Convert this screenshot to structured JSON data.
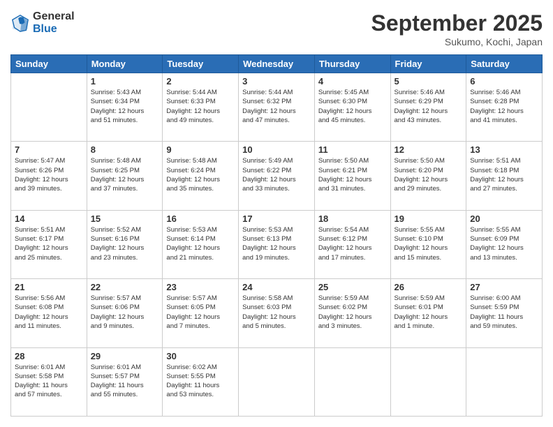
{
  "logo": {
    "general": "General",
    "blue": "Blue"
  },
  "header": {
    "month": "September 2025",
    "location": "Sukumo, Kochi, Japan"
  },
  "days_of_week": [
    "Sunday",
    "Monday",
    "Tuesday",
    "Wednesday",
    "Thursday",
    "Friday",
    "Saturday"
  ],
  "weeks": [
    [
      {
        "day": "",
        "info": ""
      },
      {
        "day": "1",
        "info": "Sunrise: 5:43 AM\nSunset: 6:34 PM\nDaylight: 12 hours\nand 51 minutes."
      },
      {
        "day": "2",
        "info": "Sunrise: 5:44 AM\nSunset: 6:33 PM\nDaylight: 12 hours\nand 49 minutes."
      },
      {
        "day": "3",
        "info": "Sunrise: 5:44 AM\nSunset: 6:32 PM\nDaylight: 12 hours\nand 47 minutes."
      },
      {
        "day": "4",
        "info": "Sunrise: 5:45 AM\nSunset: 6:30 PM\nDaylight: 12 hours\nand 45 minutes."
      },
      {
        "day": "5",
        "info": "Sunrise: 5:46 AM\nSunset: 6:29 PM\nDaylight: 12 hours\nand 43 minutes."
      },
      {
        "day": "6",
        "info": "Sunrise: 5:46 AM\nSunset: 6:28 PM\nDaylight: 12 hours\nand 41 minutes."
      }
    ],
    [
      {
        "day": "7",
        "info": "Sunrise: 5:47 AM\nSunset: 6:26 PM\nDaylight: 12 hours\nand 39 minutes."
      },
      {
        "day": "8",
        "info": "Sunrise: 5:48 AM\nSunset: 6:25 PM\nDaylight: 12 hours\nand 37 minutes."
      },
      {
        "day": "9",
        "info": "Sunrise: 5:48 AM\nSunset: 6:24 PM\nDaylight: 12 hours\nand 35 minutes."
      },
      {
        "day": "10",
        "info": "Sunrise: 5:49 AM\nSunset: 6:22 PM\nDaylight: 12 hours\nand 33 minutes."
      },
      {
        "day": "11",
        "info": "Sunrise: 5:50 AM\nSunset: 6:21 PM\nDaylight: 12 hours\nand 31 minutes."
      },
      {
        "day": "12",
        "info": "Sunrise: 5:50 AM\nSunset: 6:20 PM\nDaylight: 12 hours\nand 29 minutes."
      },
      {
        "day": "13",
        "info": "Sunrise: 5:51 AM\nSunset: 6:18 PM\nDaylight: 12 hours\nand 27 minutes."
      }
    ],
    [
      {
        "day": "14",
        "info": "Sunrise: 5:51 AM\nSunset: 6:17 PM\nDaylight: 12 hours\nand 25 minutes."
      },
      {
        "day": "15",
        "info": "Sunrise: 5:52 AM\nSunset: 6:16 PM\nDaylight: 12 hours\nand 23 minutes."
      },
      {
        "day": "16",
        "info": "Sunrise: 5:53 AM\nSunset: 6:14 PM\nDaylight: 12 hours\nand 21 minutes."
      },
      {
        "day": "17",
        "info": "Sunrise: 5:53 AM\nSunset: 6:13 PM\nDaylight: 12 hours\nand 19 minutes."
      },
      {
        "day": "18",
        "info": "Sunrise: 5:54 AM\nSunset: 6:12 PM\nDaylight: 12 hours\nand 17 minutes."
      },
      {
        "day": "19",
        "info": "Sunrise: 5:55 AM\nSunset: 6:10 PM\nDaylight: 12 hours\nand 15 minutes."
      },
      {
        "day": "20",
        "info": "Sunrise: 5:55 AM\nSunset: 6:09 PM\nDaylight: 12 hours\nand 13 minutes."
      }
    ],
    [
      {
        "day": "21",
        "info": "Sunrise: 5:56 AM\nSunset: 6:08 PM\nDaylight: 12 hours\nand 11 minutes."
      },
      {
        "day": "22",
        "info": "Sunrise: 5:57 AM\nSunset: 6:06 PM\nDaylight: 12 hours\nand 9 minutes."
      },
      {
        "day": "23",
        "info": "Sunrise: 5:57 AM\nSunset: 6:05 PM\nDaylight: 12 hours\nand 7 minutes."
      },
      {
        "day": "24",
        "info": "Sunrise: 5:58 AM\nSunset: 6:03 PM\nDaylight: 12 hours\nand 5 minutes."
      },
      {
        "day": "25",
        "info": "Sunrise: 5:59 AM\nSunset: 6:02 PM\nDaylight: 12 hours\nand 3 minutes."
      },
      {
        "day": "26",
        "info": "Sunrise: 5:59 AM\nSunset: 6:01 PM\nDaylight: 12 hours\nand 1 minute."
      },
      {
        "day": "27",
        "info": "Sunrise: 6:00 AM\nSunset: 5:59 PM\nDaylight: 11 hours\nand 59 minutes."
      }
    ],
    [
      {
        "day": "28",
        "info": "Sunrise: 6:01 AM\nSunset: 5:58 PM\nDaylight: 11 hours\nand 57 minutes."
      },
      {
        "day": "29",
        "info": "Sunrise: 6:01 AM\nSunset: 5:57 PM\nDaylight: 11 hours\nand 55 minutes."
      },
      {
        "day": "30",
        "info": "Sunrise: 6:02 AM\nSunset: 5:55 PM\nDaylight: 11 hours\nand 53 minutes."
      },
      {
        "day": "",
        "info": ""
      },
      {
        "day": "",
        "info": ""
      },
      {
        "day": "",
        "info": ""
      },
      {
        "day": "",
        "info": ""
      }
    ]
  ]
}
